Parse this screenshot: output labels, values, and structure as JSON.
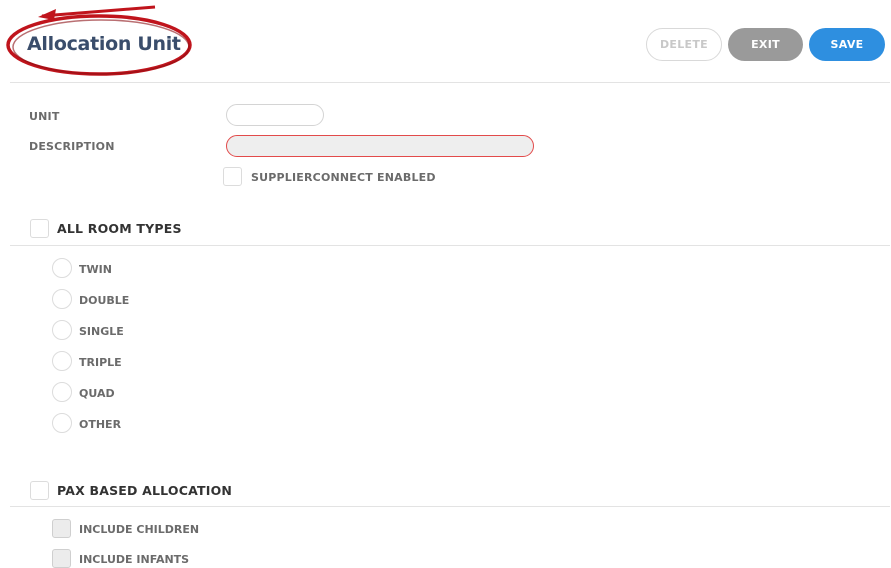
{
  "header": {
    "title": "Allocation Unit",
    "buttons": {
      "delete": "DELETE",
      "exit": "EXIT",
      "save": "SAVE"
    }
  },
  "form": {
    "unit_label": "UNIT",
    "unit_value": "",
    "description_label": "DESCRIPTION",
    "description_value": "",
    "supplierconnect_label": "SUPPLIERCONNECT ENABLED"
  },
  "room_types": {
    "title": "ALL ROOM TYPES",
    "options": [
      "TWIN",
      "DOUBLE",
      "SINGLE",
      "TRIPLE",
      "QUAD",
      "OTHER"
    ]
  },
  "pax": {
    "title": "PAX BASED ALLOCATION",
    "options": [
      "INCLUDE CHILDREN",
      "INCLUDE INFANTS"
    ]
  },
  "colors": {
    "accent": "#2e8fe0",
    "title": "#3a4d6b",
    "annotation": "#c0141c",
    "error_border": "#e24a4a"
  }
}
